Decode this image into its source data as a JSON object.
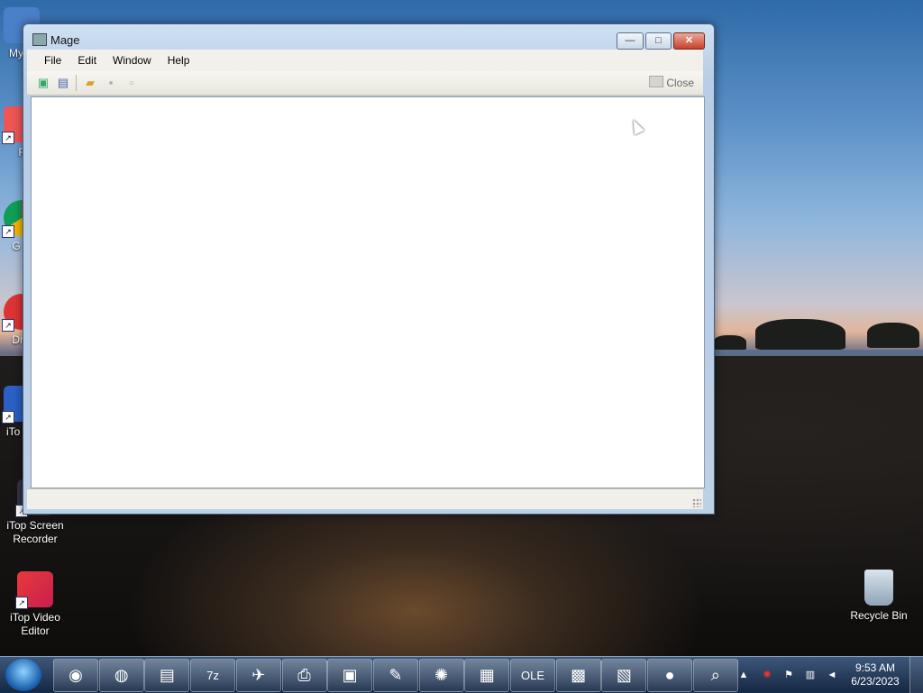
{
  "desktop": {
    "icons": [
      {
        "label": "My C",
        "icon": "computer-icon"
      },
      {
        "label": "F",
        "icon": "app-shortcut-icon"
      },
      {
        "label": "G C",
        "icon": "chrome-shortcut-icon"
      },
      {
        "label": "Driv",
        "icon": "driver-shortcut-icon"
      },
      {
        "label": "iTo Re",
        "icon": "itop-shortcut-icon"
      },
      {
        "label": "iTop Screen Recorder",
        "icon": "screen-recorder-icon"
      },
      {
        "label": "iTop Video Editor",
        "icon": "video-editor-icon"
      },
      {
        "label": "Recycle Bin",
        "icon": "recycle-bin-icon"
      }
    ]
  },
  "window": {
    "title": "Mage",
    "controls": {
      "minimize": "—",
      "maximize": "□",
      "close": "✕"
    },
    "menu": [
      "File",
      "Edit",
      "Window",
      "Help"
    ],
    "toolbar": {
      "icons": [
        "new-image-icon",
        "new-document-icon",
        "open-folder-icon",
        "save-icon",
        "save-all-icon"
      ],
      "close_label": "Close"
    }
  },
  "taskbar": {
    "apps": [
      {
        "name": "chrome-icon",
        "glyph": "◉"
      },
      {
        "name": "firefox-icon",
        "glyph": "◍"
      },
      {
        "name": "file-explorer-icon",
        "glyph": "▤"
      },
      {
        "name": "7zip-icon",
        "glyph": "7z"
      },
      {
        "name": "paper-plane-icon",
        "glyph": "✈"
      },
      {
        "name": "printer-icon",
        "glyph": "⎙"
      },
      {
        "name": "control-panel-icon",
        "glyph": "▣"
      },
      {
        "name": "paint-icon",
        "glyph": "✎"
      },
      {
        "name": "settings-red-icon",
        "glyph": "✺"
      },
      {
        "name": "photo-viewer-icon",
        "glyph": "▦"
      },
      {
        "name": "ole-viewer-icon",
        "glyph": "OLE"
      },
      {
        "name": "network-app-icon",
        "glyph": "▩"
      },
      {
        "name": "window-settings-icon",
        "glyph": "▧"
      },
      {
        "name": "video-recorder-icon",
        "glyph": "●"
      },
      {
        "name": "magnifier-app-icon",
        "glyph": "⌕"
      }
    ],
    "tray": {
      "time": "9:53 AM",
      "date": "6/23/2023",
      "icons": [
        "show-hidden-icons-arrow",
        "security-icon",
        "action-center-flag-icon",
        "network-icon",
        "volume-muted-icon"
      ]
    }
  }
}
